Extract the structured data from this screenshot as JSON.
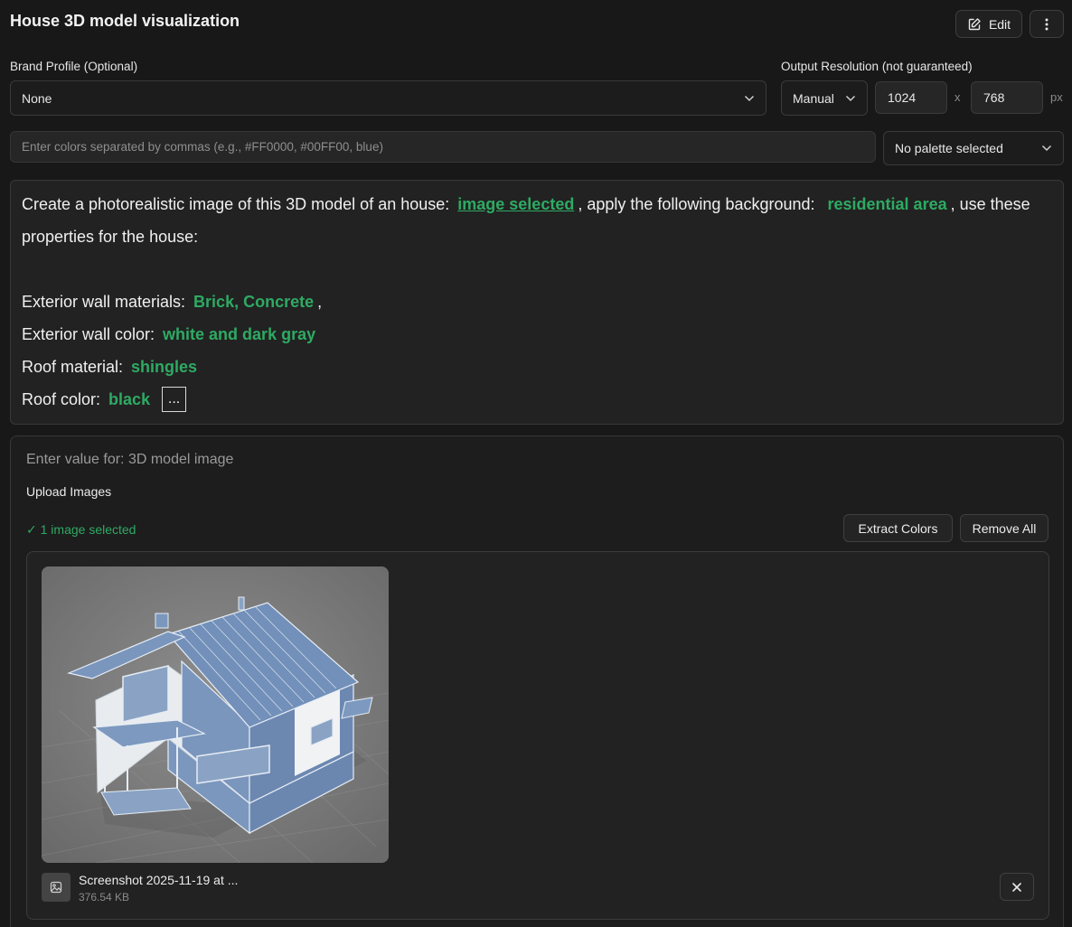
{
  "header": {
    "title": "House 3D model visualization",
    "edit_label": "Edit"
  },
  "brand": {
    "label": "Brand Profile (Optional)",
    "value": "None"
  },
  "resolution": {
    "label": "Output Resolution (not guaranteed)",
    "mode": "Manual",
    "width": "1024",
    "height": "768",
    "times": "x",
    "unit": "px"
  },
  "colors": {
    "placeholder": "Enter colors separated by commas (e.g., #FF0000, #00FF00, blue)",
    "palette": "No palette selected"
  },
  "prompt": {
    "p1": "Create a photorealistic image of this 3D model of an house:",
    "v_image": "image selected",
    "p2": ", apply the following background:",
    "v_background": "residential area",
    "p3": ", use these",
    "p4": "properties for the house:",
    "l_materials": "Exterior wall materials:",
    "v_materials": "Brick, Concrete",
    "comma": ",",
    "l_wall_color": "Exterior wall color:",
    "v_wall_color": "white and dark gray",
    "l_roof_material": "Roof material:",
    "v_roof_material": "shingles",
    "l_roof_color": "Roof color:",
    "v_roof_color": "black",
    "more": "..."
  },
  "upload": {
    "enter_value": "Enter value for: 3D model image",
    "title": "Upload Images",
    "status": "✓ 1 image selected",
    "extract_colors": "Extract Colors",
    "remove_all": "Remove All",
    "file_name": "Screenshot 2025-11-19 at ...",
    "file_size": "376.54 KB"
  },
  "colors_theme": {
    "accent_green": "#2eaa63",
    "background": "#181818",
    "house_blue": "#6b8bb5"
  }
}
